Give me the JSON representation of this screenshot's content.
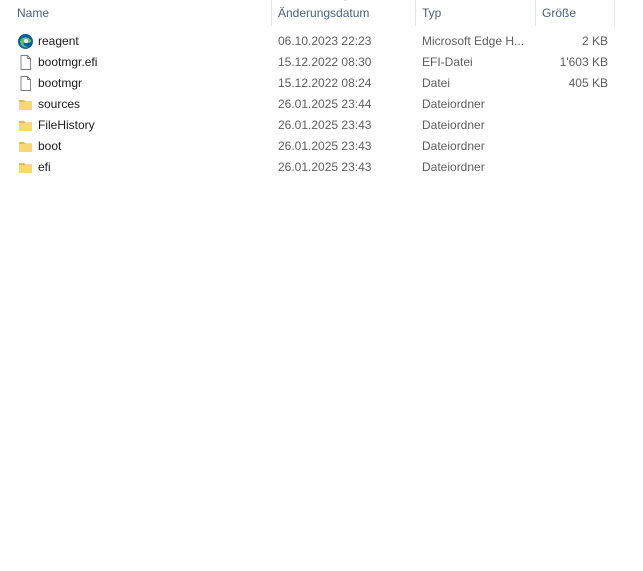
{
  "columns": {
    "name": "Name",
    "date": "Änderungsdatum",
    "type": "Typ",
    "size": "Größe"
  },
  "sort": {
    "column": "date",
    "direction": "descending"
  },
  "files": [
    {
      "name": "reagent",
      "date": "06.10.2023 22:23",
      "type": "Microsoft Edge H...",
      "size": "2 KB",
      "icon": "edge-html-icon"
    },
    {
      "name": "bootmgr.efi",
      "date": "15.12.2022 08:30",
      "type": "EFI-Datei",
      "size": "1'603 KB",
      "icon": "file-icon"
    },
    {
      "name": "bootmgr",
      "date": "15.12.2022 08:24",
      "type": "Datei",
      "size": "405 KB",
      "icon": "file-icon"
    },
    {
      "name": "sources",
      "date": "26.01.2025 23:44",
      "type": "Dateiordner",
      "size": "",
      "icon": "folder-icon"
    },
    {
      "name": "FileHistory",
      "date": "26.01.2025 23:43",
      "type": "Dateiordner",
      "size": "",
      "icon": "folder-icon"
    },
    {
      "name": "boot",
      "date": "26.01.2025 23:43",
      "type": "Dateiordner",
      "size": "",
      "icon": "folder-icon"
    },
    {
      "name": "efi",
      "date": "26.01.2025 23:43",
      "type": "Dateiordner",
      "size": "",
      "icon": "folder-icon"
    }
  ],
  "colors": {
    "header_text": "#4c607a",
    "folder": "#f8d775",
    "folder_dark": "#e8b84a",
    "edge_blue": "#0c59a4",
    "edge_green": "#54c36d"
  }
}
